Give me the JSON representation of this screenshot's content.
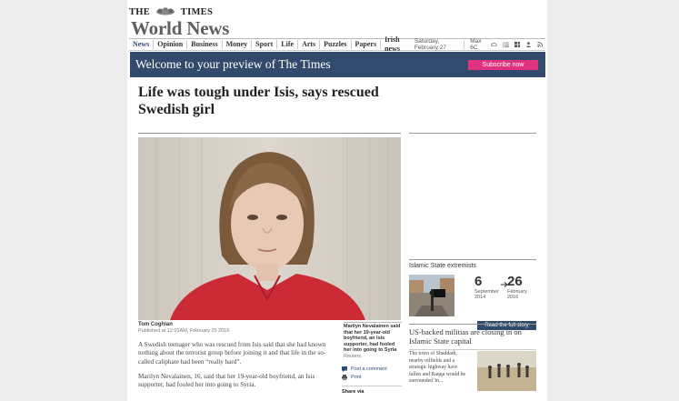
{
  "masthead": {
    "left": "THE",
    "right": "TIMES"
  },
  "section_title": "World News",
  "nav": {
    "items": [
      "News",
      "Opinion",
      "Business",
      "Money",
      "Sport",
      "Life",
      "Arts",
      "Puzzles",
      "Papers",
      "Irish news"
    ],
    "date": "Saturday, February 27",
    "weather": "Max 6C"
  },
  "preview": {
    "text": "Welcome to your preview of The Times",
    "subscribe_label": "Subscribe now"
  },
  "article": {
    "headline": "Life was tough under Isis, says rescued Swedish girl",
    "author": "Tom Coghlan",
    "published": "Published at 12:01AM, February 25 2016",
    "caption": "Marilyn Nevalainen said that her 19-year-old boyfriend, an Isis supporter, had fooled her into going to Syria",
    "caption_credit": "Reuters",
    "paragraphs": [
      "A Swedish teenager who was rescued from Isis said that she had known nothing about the terrorist group before joining it and that life in the so-called caliphate had been “really hard”.",
      "Marilyn Nevalainen, 16, said that her 19-year-old boyfriend, an Isis supporter, had fooled her into going to Syria."
    ],
    "actions": {
      "comment": "Post a comment",
      "print": "Print",
      "share": "Share via"
    }
  },
  "sidebar": {
    "timeline": {
      "label": "Islamic State extremists",
      "start": {
        "day": "6",
        "month": "September",
        "year": "2014"
      },
      "end": {
        "day": "26",
        "month": "February",
        "year": "2016"
      },
      "button": "Read the full story"
    },
    "story": {
      "title": "US-backed militias are closing in on Islamic State capital",
      "text": "The town of Shaddadi, nearby oilfields and a strategic highway have fallen and Raqqa would be surrounded 'in..."
    }
  },
  "colors": {
    "brand_navy": "#324a6b",
    "subscribe_pink": "#e0327e"
  }
}
